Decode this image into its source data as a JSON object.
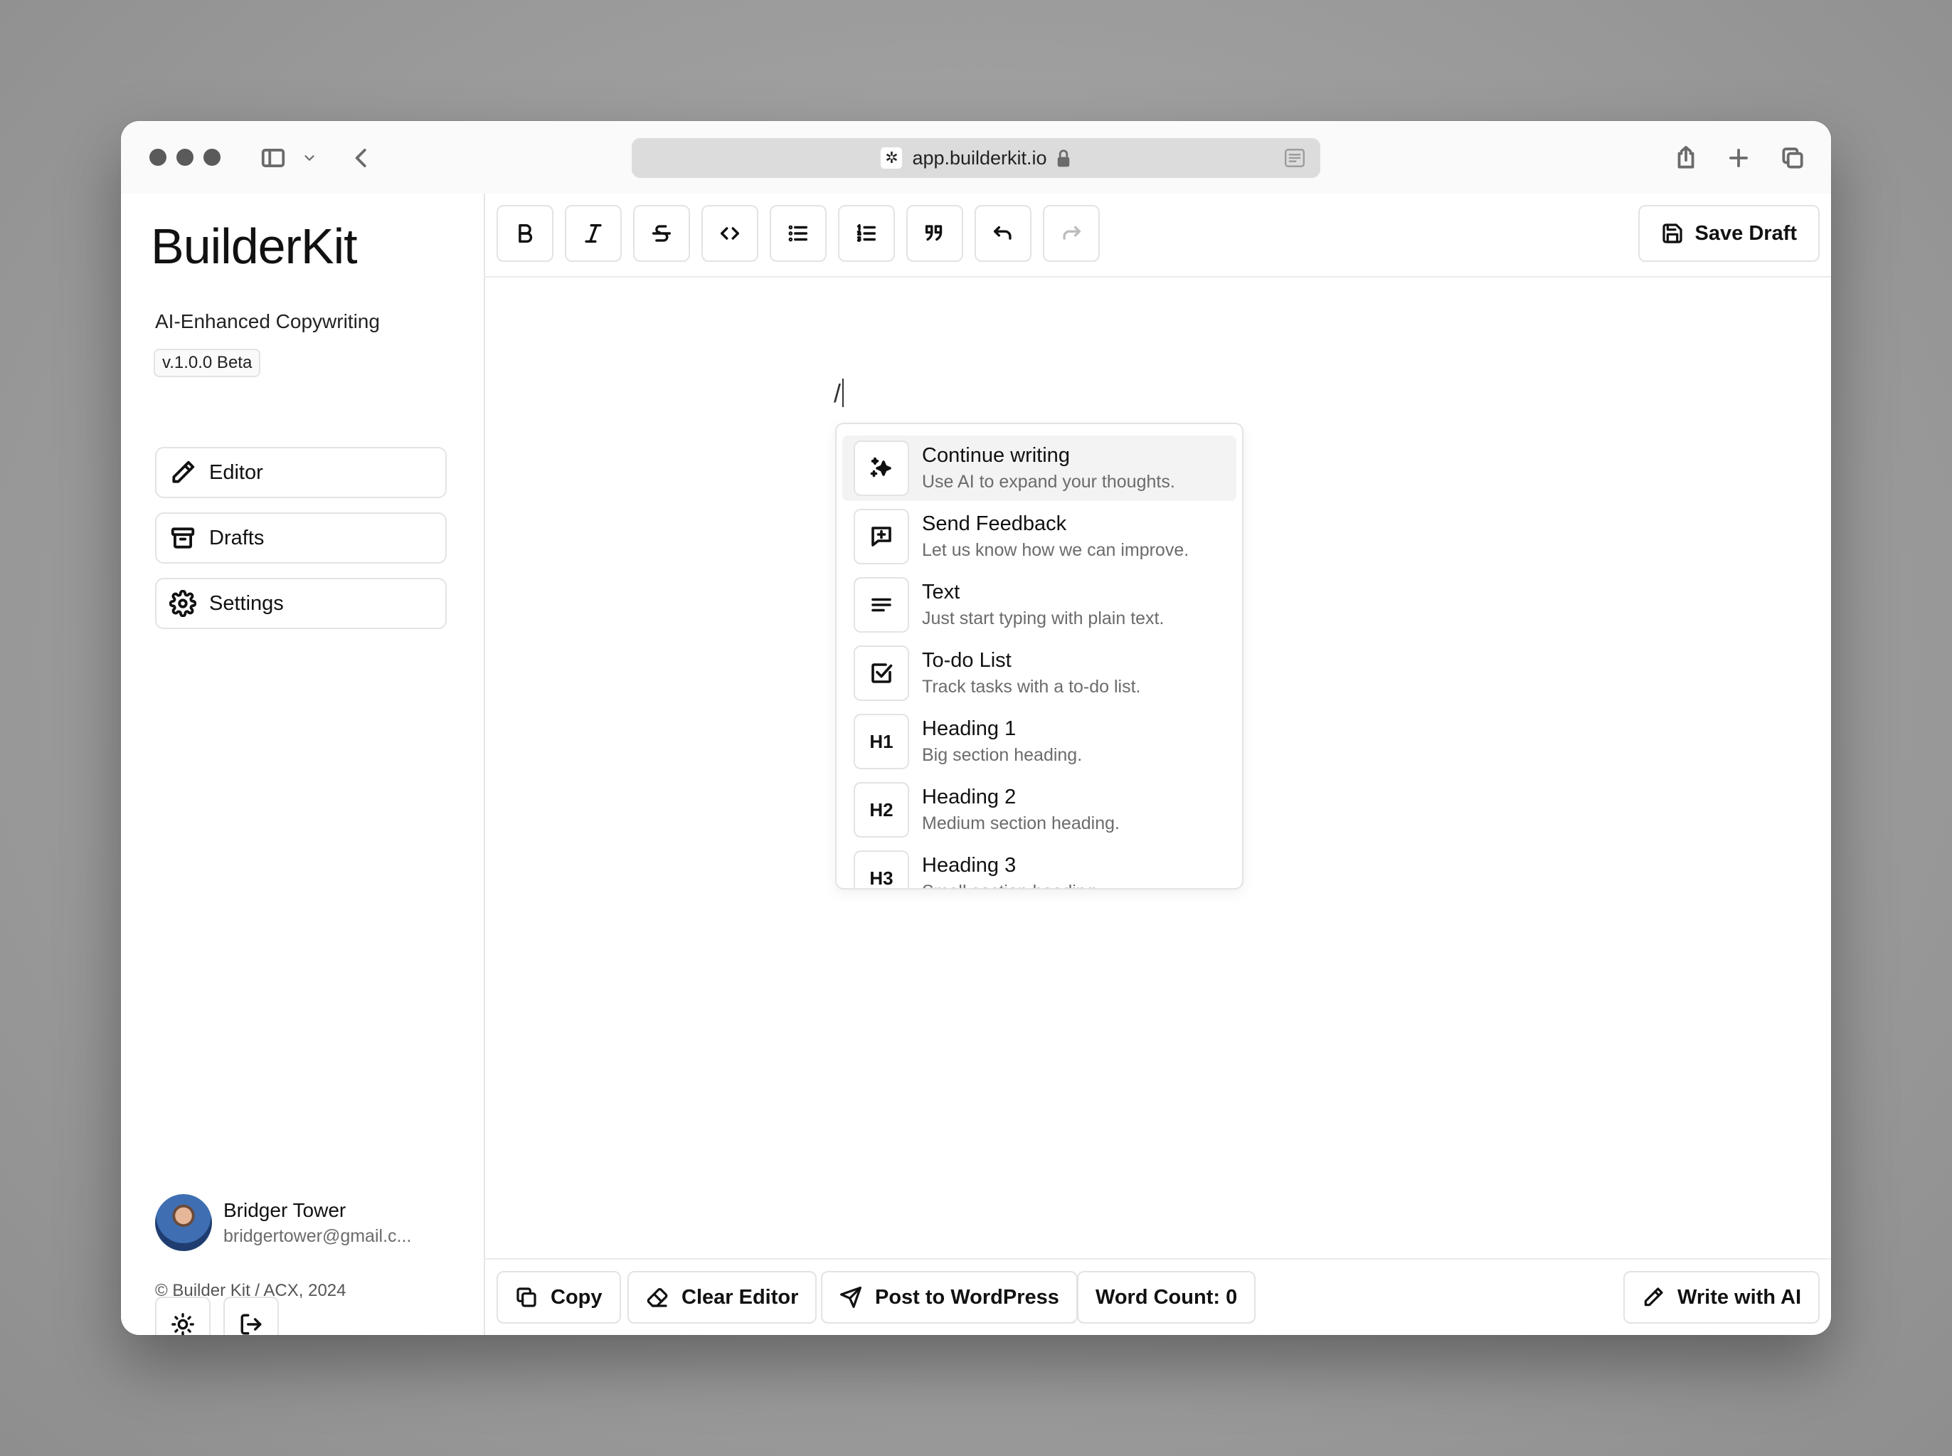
{
  "browser": {
    "url": "app.builderkit.io"
  },
  "sidebar": {
    "brand": "BuilderKit",
    "tagline": "AI-Enhanced Copywriting",
    "version": "v.1.0.0 Beta",
    "nav": [
      {
        "label": "Editor",
        "icon": "pencil-icon"
      },
      {
        "label": "Drafts",
        "icon": "archive-icon"
      },
      {
        "label": "Settings",
        "icon": "gear-icon"
      }
    ],
    "user": {
      "name": "Bridger Tower",
      "email": "bridgertower@gmail.c..."
    },
    "copyright": "© Builder Kit / ACX, 2024"
  },
  "toolbar": {
    "tools": [
      "B",
      "I",
      "S",
      "code",
      "bullet-list",
      "ordered-list",
      "quote",
      "undo",
      "redo"
    ],
    "save_label": "Save Draft"
  },
  "editor": {
    "typed": "/"
  },
  "slash_menu": {
    "items": [
      {
        "title": "Continue writing",
        "desc": "Use AI to expand your thoughts.",
        "icon": "sparkles-icon"
      },
      {
        "title": "Send Feedback",
        "desc": "Let us know how we can improve.",
        "icon": "feedback-icon"
      },
      {
        "title": "Text",
        "desc": "Just start typing with plain text.",
        "icon": "text-icon"
      },
      {
        "title": "To-do List",
        "desc": "Track tasks with a to-do list.",
        "icon": "checkbox-icon"
      },
      {
        "title": "Heading 1",
        "desc": "Big section heading.",
        "icon_text": "H1"
      },
      {
        "title": "Heading 2",
        "desc": "Medium section heading.",
        "icon_text": "H2"
      },
      {
        "title": "Heading 3",
        "desc": "Small section heading.",
        "icon_text": "H3"
      }
    ]
  },
  "bottombar": {
    "copy": "Copy",
    "clear": "Clear Editor",
    "post": "Post to WordPress",
    "word_count": "Word Count: 0",
    "write_ai": "Write with AI"
  }
}
